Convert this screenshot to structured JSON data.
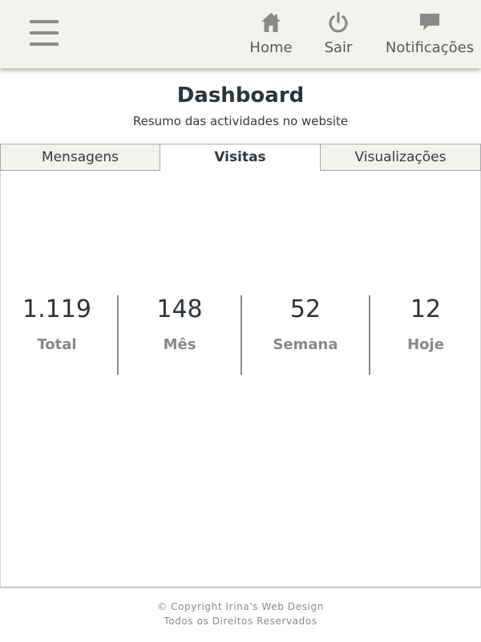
{
  "header": {
    "menu_icon": "hamburger-menu-icon",
    "nav": [
      {
        "label": "Home",
        "icon": "home-icon"
      },
      {
        "label": "Sair",
        "icon": "power-icon"
      },
      {
        "label": "Notificações",
        "icon": "speech-bubble-icon"
      }
    ],
    "icon_color": "#8a8a8a",
    "background": "#f4f2ed"
  },
  "page": {
    "title": "Dashboard",
    "subtitle": "Resumo das actividades no website"
  },
  "tabs": [
    {
      "label": "Mensagens",
      "active": false
    },
    {
      "label": "Visitas",
      "active": true
    },
    {
      "label": "Visualizações",
      "active": false
    }
  ],
  "stats": [
    {
      "value": "1.119",
      "label": "Total"
    },
    {
      "value": "148",
      "label": "Mês"
    },
    {
      "value": "52",
      "label": "Semana"
    },
    {
      "value": "12",
      "label": "Hoje"
    }
  ],
  "footer": {
    "copyright": "© Copyright Irina's Web Design",
    "rights": "Todos os Direitos Reservados"
  }
}
